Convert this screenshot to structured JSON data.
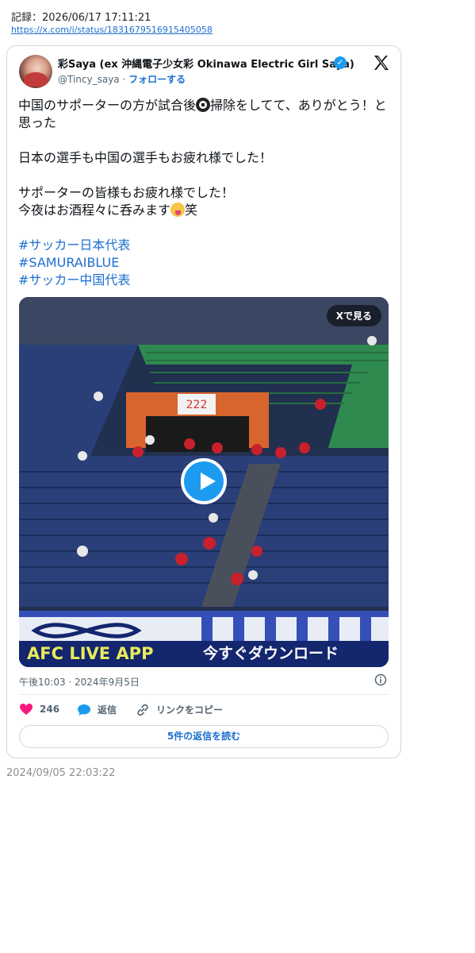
{
  "record": {
    "text": "記録：2026/06/17 17:11:21",
    "url": "https://x.com/i/status/1831679516915405058"
  },
  "tweet": {
    "display_name": "彩Saya (ex 沖縄電子少女彩 Okinawa Electric Girl Saya)",
    "handle": "@Tincy_saya",
    "separator": "·",
    "follow_label": "フォローする",
    "body": {
      "line1a": "中国のサポーターの方が試合後",
      "line1b": "掃除をしてて、ありがとう！と思った",
      "line2": "日本の選手も中国の選手もお疲れ様でした！",
      "line3": "サポーターの皆様もお疲れ様でした！",
      "line4a": "今夜はお酒程々に呑みます",
      "line4b": "笑",
      "hashtags": [
        "#サッカー日本代表",
        "#SAMURAIBLUE",
        "#サッカー中国代表"
      ]
    },
    "media": {
      "view_on_x": "Xで見る",
      "banner_left": "AFC LIVE APP",
      "banner_right": "今すぐダウンロード",
      "sign_number": "222"
    },
    "timestamp": "午後10:03 · 2024年9月5日",
    "likes": "246",
    "reply_label": "返信",
    "copy_link_label": "リンクをコピー",
    "read_replies": "5件の返信を読む"
  },
  "footer_date": "2024/09/05 22:03:22",
  "colors": {
    "accent": "#1d9bf0",
    "link": "#1d6fd0",
    "like": "#f91880",
    "stand_green": "#2f8a4f",
    "stand_blue": "#2a3f78"
  },
  "icons": [
    "verified-badge-icon",
    "x-logo-icon",
    "soccer-ball-emoji-icon",
    "tongue-face-emoji-icon",
    "play-icon",
    "heart-icon",
    "reply-bubble-icon",
    "link-icon",
    "info-icon"
  ]
}
